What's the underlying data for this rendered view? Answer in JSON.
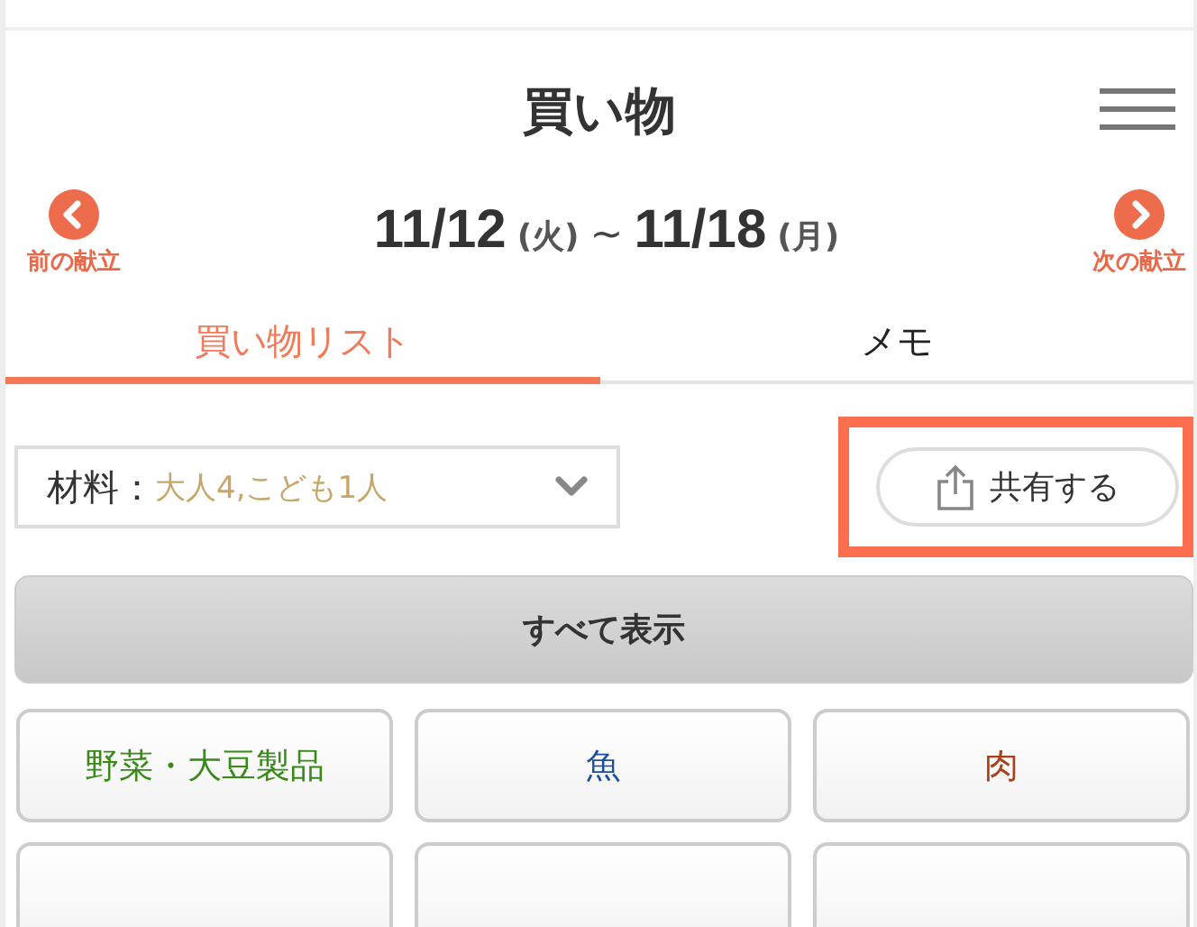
{
  "header": {
    "title": "買い物"
  },
  "week": {
    "start": "11/12",
    "start_day": "(火)",
    "separator": "~",
    "end": "11/18",
    "end_day": "(月)",
    "prev_label": "前の献立",
    "next_label": "次の献立"
  },
  "tabs": [
    {
      "label": "買い物リスト",
      "selected": true
    },
    {
      "label": "メモ",
      "selected": false
    }
  ],
  "servings": {
    "label": "材料：",
    "value": "大人4,こども1人"
  },
  "share_button": {
    "label": "共有する",
    "highlighted": true
  },
  "show_all_button": {
    "label": "すべて表示"
  },
  "categories": [
    {
      "kind": "text",
      "label": "野菜・大豆製品",
      "color": "#3a8a1a"
    },
    {
      "kind": "text",
      "label": "魚",
      "color": "#1a4fa0"
    },
    {
      "kind": "text",
      "label": "肉",
      "color": "#a8401a"
    },
    {
      "kind": "cut"
    },
    {
      "kind": "cut"
    },
    {
      "kind": "cut"
    }
  ]
}
